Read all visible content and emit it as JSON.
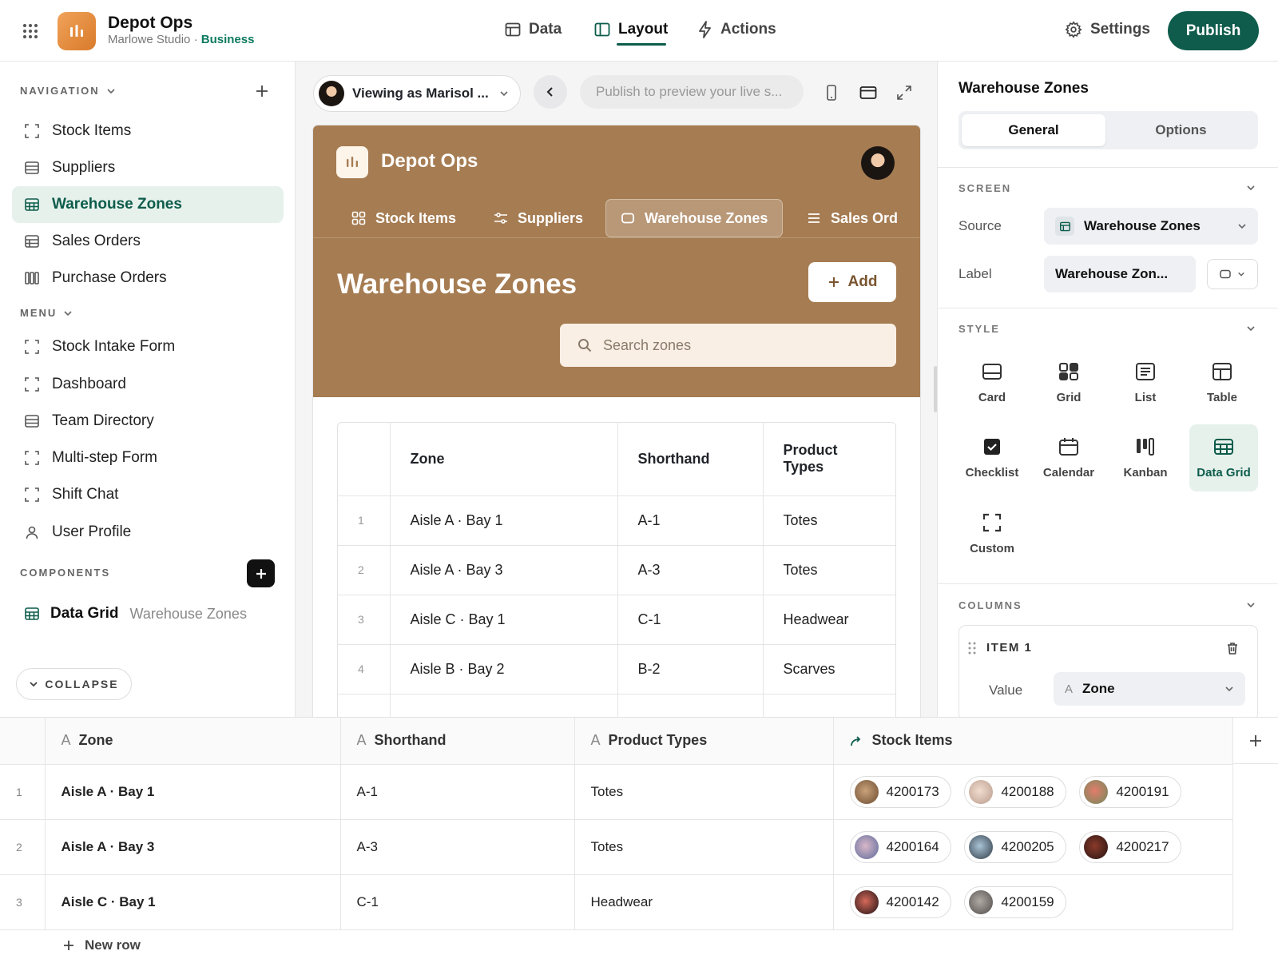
{
  "app": {
    "title": "Depot Ops",
    "studio": "Marlowe Studio",
    "separator": "·",
    "plan": "Business"
  },
  "topnav": [
    {
      "label": "Data",
      "icon": "table-icon"
    },
    {
      "label": "Layout",
      "icon": "layout-icon"
    },
    {
      "label": "Actions",
      "icon": "bolt-icon"
    }
  ],
  "settings_label": "Settings",
  "publish_label": "Publish",
  "sidebar": {
    "navigation_label": "NAVIGATION",
    "nav_items": [
      {
        "label": "Stock Items",
        "icon": "frame-icon"
      },
      {
        "label": "Suppliers",
        "icon": "list-icon"
      },
      {
        "label": "Warehouse Zones",
        "icon": "grid-table-icon",
        "active": true
      },
      {
        "label": "Sales Orders",
        "icon": "table-icon"
      },
      {
        "label": "Purchase Orders",
        "icon": "kanban-icon"
      }
    ],
    "menu_label": "MENU",
    "menu_items": [
      {
        "label": "Stock Intake Form",
        "icon": "frame-icon"
      },
      {
        "label": "Dashboard",
        "icon": "frame-icon"
      },
      {
        "label": "Team Directory",
        "icon": "list-icon"
      },
      {
        "label": "Multi-step Form",
        "icon": "frame-icon"
      },
      {
        "label": "Shift Chat",
        "icon": "frame-icon"
      },
      {
        "label": "User Profile",
        "icon": "user-icon"
      }
    ],
    "components_label": "COMPONENTS",
    "component": {
      "type": "Data Grid",
      "source": "Warehouse Zones"
    },
    "collapse_label": "COLLAPSE"
  },
  "preview": {
    "viewing_as": "Viewing as Marisol ...",
    "url_placeholder": "Publish to preview your live s...",
    "app_title": "Depot Ops",
    "tabs": [
      {
        "label": "Stock Items",
        "icon": "grid-icon"
      },
      {
        "label": "Suppliers",
        "icon": "sliders-icon"
      },
      {
        "label": "Warehouse Zones",
        "icon": "square-icon",
        "active": true
      },
      {
        "label": "Sales Ord",
        "icon": "menu-icon"
      }
    ],
    "screen_title": "Warehouse Zones",
    "add_label": "Add",
    "search_placeholder": "Search zones",
    "table": {
      "headers": [
        "Zone",
        "Shorthand",
        "Product Types"
      ],
      "rows": [
        {
          "n": "1",
          "zone": "Aisle A · Bay 1",
          "short": "A-1",
          "types": "Totes"
        },
        {
          "n": "2",
          "zone": "Aisle A · Bay 3",
          "short": "A-3",
          "types": "Totes"
        },
        {
          "n": "3",
          "zone": "Aisle C · Bay 1",
          "short": "C-1",
          "types": "Headwear"
        },
        {
          "n": "4",
          "zone": "Aisle B · Bay 2",
          "short": "B-2",
          "types": "Scarves"
        }
      ]
    }
  },
  "panel": {
    "title": "Warehouse Zones",
    "tabs": [
      "General",
      "Options"
    ],
    "screen_label": "SCREEN",
    "source_label": "Source",
    "source_value": "Warehouse Zones",
    "label_label": "Label",
    "label_value": "Warehouse Zon...",
    "style_label": "STYLE",
    "styles": [
      {
        "label": "Card",
        "icon": "card-icon"
      },
      {
        "label": "Grid",
        "icon": "grid-icon"
      },
      {
        "label": "List",
        "icon": "list-icon"
      },
      {
        "label": "Table",
        "icon": "table-icon"
      },
      {
        "label": "Checklist",
        "icon": "checkbox-icon"
      },
      {
        "label": "Calendar",
        "icon": "calendar-icon"
      },
      {
        "label": "Kanban",
        "icon": "kanban-icon"
      },
      {
        "label": "Data Grid",
        "icon": "data-grid-icon",
        "active": true
      },
      {
        "label": "Custom",
        "icon": "frame-icon"
      }
    ],
    "columns_label": "COLUMNS",
    "column_item": "ITEM 1",
    "value_label": "Value",
    "value_type": "A",
    "value_field": "Zone"
  },
  "grid": {
    "headers": [
      {
        "label": "Zone",
        "type": "A"
      },
      {
        "label": "Shorthand",
        "type": "A"
      },
      {
        "label": "Product Types",
        "type": "A"
      },
      {
        "label": "Stock Items",
        "type": "relation-icon"
      }
    ],
    "rows": [
      {
        "n": "1",
        "zone": "Aisle A · Bay 1",
        "short": "A-1",
        "types": "Totes",
        "items": [
          "4200173",
          "4200188",
          "4200191"
        ]
      },
      {
        "n": "2",
        "zone": "Aisle A · Bay 3",
        "short": "A-3",
        "types": "Totes",
        "items": [
          "4200164",
          "4200205",
          "4200217"
        ]
      },
      {
        "n": "3",
        "zone": "Aisle C · Bay 1",
        "short": "C-1",
        "types": "Headwear",
        "items": [
          "4200142",
          "4200159"
        ]
      }
    ],
    "new_row_label": "New row"
  },
  "colors": {
    "accent": "#0f5c4c",
    "header_brown": "#a67c52",
    "active_bg": "#e6f1ec"
  }
}
